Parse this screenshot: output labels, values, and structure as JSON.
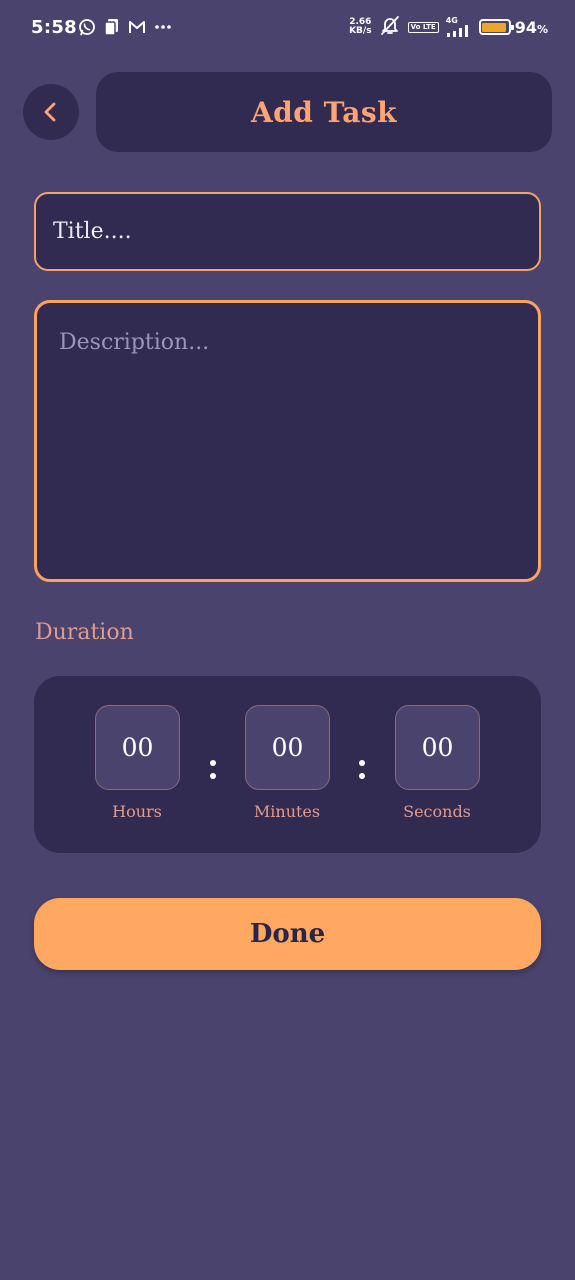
{
  "status_bar": {
    "time": "5:58",
    "left_icons": [
      "whatsapp-icon",
      "sim-card-icon",
      "gmail-icon",
      "more-dots-icon"
    ],
    "net_speed_value": "2.66",
    "net_speed_unit": "KB/s",
    "volte_label": "Vo LTE",
    "network_label": "4G",
    "battery_percent_value": "94",
    "battery_percent_unit": "%",
    "battery_level": 0.94,
    "battery_color": "#f0a623"
  },
  "header": {
    "back_icon": "chevron-left-icon",
    "title": "Add Task"
  },
  "form": {
    "title_field": {
      "placeholder": "Title....",
      "value": ""
    },
    "description_field": {
      "placeholder": "Description...",
      "value": ""
    }
  },
  "duration": {
    "label": "Duration",
    "hours": {
      "value": "00",
      "caption": "Hours"
    },
    "minutes": {
      "value": "00",
      "caption": "Minutes"
    },
    "seconds": {
      "value": "00",
      "caption": "Seconds"
    }
  },
  "actions": {
    "done_label": "Done"
  },
  "colors": {
    "background": "#4a436d",
    "card": "#312b52",
    "accent": "#ffa861",
    "accent_text": "#ffa472",
    "label": "#e29a8b"
  }
}
